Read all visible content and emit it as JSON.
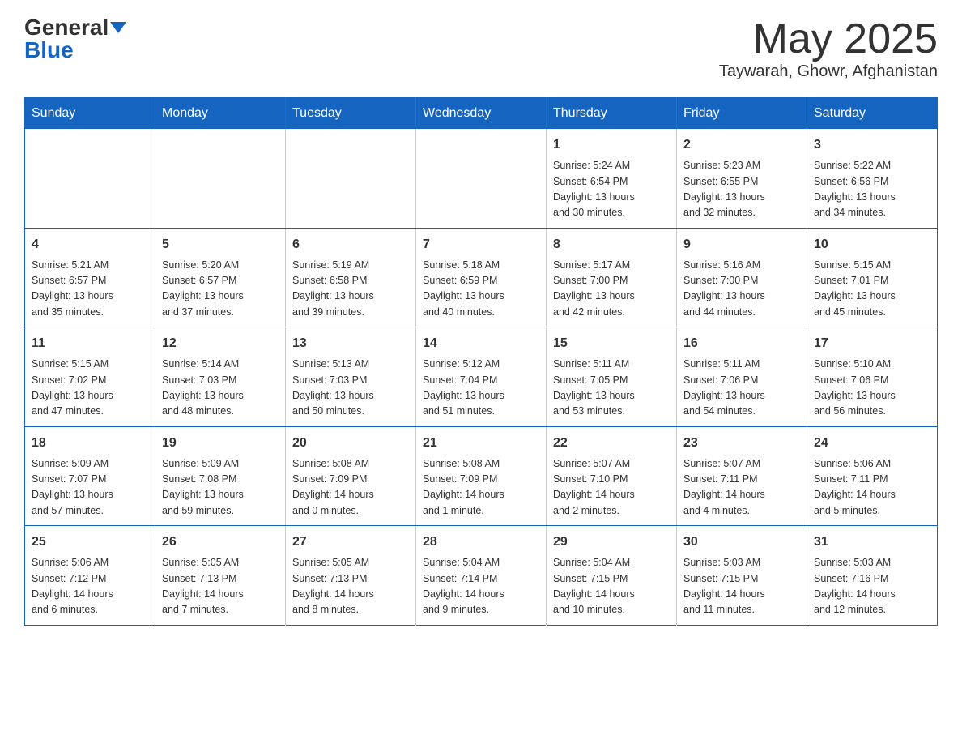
{
  "header": {
    "logo_general": "General",
    "logo_blue": "Blue",
    "month_title": "May 2025",
    "location": "Taywarah, Ghowr, Afghanistan"
  },
  "weekdays": [
    "Sunday",
    "Monday",
    "Tuesday",
    "Wednesday",
    "Thursday",
    "Friday",
    "Saturday"
  ],
  "weeks": [
    [
      {
        "day": "",
        "info": ""
      },
      {
        "day": "",
        "info": ""
      },
      {
        "day": "",
        "info": ""
      },
      {
        "day": "",
        "info": ""
      },
      {
        "day": "1",
        "info": "Sunrise: 5:24 AM\nSunset: 6:54 PM\nDaylight: 13 hours\nand 30 minutes."
      },
      {
        "day": "2",
        "info": "Sunrise: 5:23 AM\nSunset: 6:55 PM\nDaylight: 13 hours\nand 32 minutes."
      },
      {
        "day": "3",
        "info": "Sunrise: 5:22 AM\nSunset: 6:56 PM\nDaylight: 13 hours\nand 34 minutes."
      }
    ],
    [
      {
        "day": "4",
        "info": "Sunrise: 5:21 AM\nSunset: 6:57 PM\nDaylight: 13 hours\nand 35 minutes."
      },
      {
        "day": "5",
        "info": "Sunrise: 5:20 AM\nSunset: 6:57 PM\nDaylight: 13 hours\nand 37 minutes."
      },
      {
        "day": "6",
        "info": "Sunrise: 5:19 AM\nSunset: 6:58 PM\nDaylight: 13 hours\nand 39 minutes."
      },
      {
        "day": "7",
        "info": "Sunrise: 5:18 AM\nSunset: 6:59 PM\nDaylight: 13 hours\nand 40 minutes."
      },
      {
        "day": "8",
        "info": "Sunrise: 5:17 AM\nSunset: 7:00 PM\nDaylight: 13 hours\nand 42 minutes."
      },
      {
        "day": "9",
        "info": "Sunrise: 5:16 AM\nSunset: 7:00 PM\nDaylight: 13 hours\nand 44 minutes."
      },
      {
        "day": "10",
        "info": "Sunrise: 5:15 AM\nSunset: 7:01 PM\nDaylight: 13 hours\nand 45 minutes."
      }
    ],
    [
      {
        "day": "11",
        "info": "Sunrise: 5:15 AM\nSunset: 7:02 PM\nDaylight: 13 hours\nand 47 minutes."
      },
      {
        "day": "12",
        "info": "Sunrise: 5:14 AM\nSunset: 7:03 PM\nDaylight: 13 hours\nand 48 minutes."
      },
      {
        "day": "13",
        "info": "Sunrise: 5:13 AM\nSunset: 7:03 PM\nDaylight: 13 hours\nand 50 minutes."
      },
      {
        "day": "14",
        "info": "Sunrise: 5:12 AM\nSunset: 7:04 PM\nDaylight: 13 hours\nand 51 minutes."
      },
      {
        "day": "15",
        "info": "Sunrise: 5:11 AM\nSunset: 7:05 PM\nDaylight: 13 hours\nand 53 minutes."
      },
      {
        "day": "16",
        "info": "Sunrise: 5:11 AM\nSunset: 7:06 PM\nDaylight: 13 hours\nand 54 minutes."
      },
      {
        "day": "17",
        "info": "Sunrise: 5:10 AM\nSunset: 7:06 PM\nDaylight: 13 hours\nand 56 minutes."
      }
    ],
    [
      {
        "day": "18",
        "info": "Sunrise: 5:09 AM\nSunset: 7:07 PM\nDaylight: 13 hours\nand 57 minutes."
      },
      {
        "day": "19",
        "info": "Sunrise: 5:09 AM\nSunset: 7:08 PM\nDaylight: 13 hours\nand 59 minutes."
      },
      {
        "day": "20",
        "info": "Sunrise: 5:08 AM\nSunset: 7:09 PM\nDaylight: 14 hours\nand 0 minutes."
      },
      {
        "day": "21",
        "info": "Sunrise: 5:08 AM\nSunset: 7:09 PM\nDaylight: 14 hours\nand 1 minute."
      },
      {
        "day": "22",
        "info": "Sunrise: 5:07 AM\nSunset: 7:10 PM\nDaylight: 14 hours\nand 2 minutes."
      },
      {
        "day": "23",
        "info": "Sunrise: 5:07 AM\nSunset: 7:11 PM\nDaylight: 14 hours\nand 4 minutes."
      },
      {
        "day": "24",
        "info": "Sunrise: 5:06 AM\nSunset: 7:11 PM\nDaylight: 14 hours\nand 5 minutes."
      }
    ],
    [
      {
        "day": "25",
        "info": "Sunrise: 5:06 AM\nSunset: 7:12 PM\nDaylight: 14 hours\nand 6 minutes."
      },
      {
        "day": "26",
        "info": "Sunrise: 5:05 AM\nSunset: 7:13 PM\nDaylight: 14 hours\nand 7 minutes."
      },
      {
        "day": "27",
        "info": "Sunrise: 5:05 AM\nSunset: 7:13 PM\nDaylight: 14 hours\nand 8 minutes."
      },
      {
        "day": "28",
        "info": "Sunrise: 5:04 AM\nSunset: 7:14 PM\nDaylight: 14 hours\nand 9 minutes."
      },
      {
        "day": "29",
        "info": "Sunrise: 5:04 AM\nSunset: 7:15 PM\nDaylight: 14 hours\nand 10 minutes."
      },
      {
        "day": "30",
        "info": "Sunrise: 5:03 AM\nSunset: 7:15 PM\nDaylight: 14 hours\nand 11 minutes."
      },
      {
        "day": "31",
        "info": "Sunrise: 5:03 AM\nSunset: 7:16 PM\nDaylight: 14 hours\nand 12 minutes."
      }
    ]
  ]
}
